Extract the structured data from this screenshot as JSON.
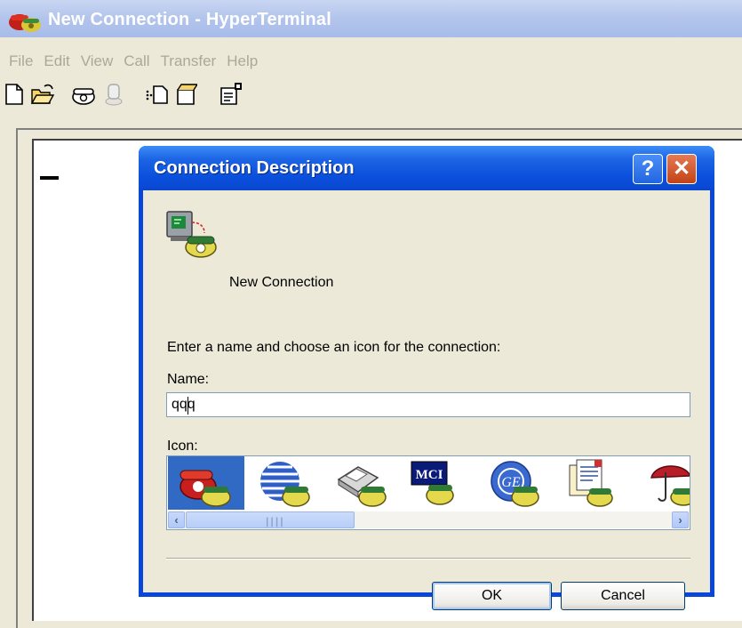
{
  "window": {
    "title": "New Connection - HyperTerminal"
  },
  "menubar": {
    "items": [
      "File",
      "Edit",
      "View",
      "Call",
      "Transfer",
      "Help"
    ]
  },
  "toolbar": {
    "buttons": [
      "new-icon",
      "open-icon",
      "call-icon",
      "disconnect-icon",
      "send-icon",
      "receive-icon",
      "properties-icon"
    ]
  },
  "dialog": {
    "title": "Connection Description",
    "help_label": "?",
    "close_label": "✕",
    "connection_label": "New Connection",
    "prompt": "Enter a name and choose an icon for the connection:",
    "name_label": "Name:",
    "name_value": "qqq",
    "icon_label": "Icon:",
    "icons": [
      "red-phone-icon",
      "blue-globe-icon",
      "fax-phone-icon",
      "mci-icon",
      "ge-globe-icon",
      "documents-icon",
      "umbrella-icon"
    ],
    "selected_icon": 0,
    "ok_label": "OK",
    "cancel_label": "Cancel"
  },
  "colors": {
    "titlebar_inactive": "#b2c4ec",
    "dialog_title": "#0a50dc",
    "selection": "#316ac5",
    "close_button": "#c24316"
  }
}
